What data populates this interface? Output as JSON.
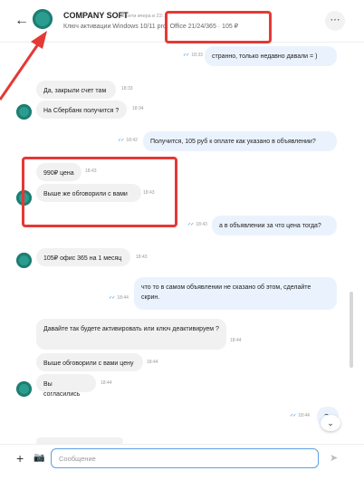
{
  "header": {
    "back_icon": "arrow-left-icon",
    "name": "COMPANY SOFT",
    "status": "В сети вчера в 22:...",
    "subtitle": "Ключ активации Windows 10/11 pro, Office 21/24/365 · 105 ₽",
    "menu": "⋯"
  },
  "messages": [
    {
      "dir": "out",
      "text": "странно, только недавно давали = )",
      "time": "18:33"
    },
    {
      "dir": "in",
      "text": "Да, закрыли счет там",
      "time": "18:33"
    },
    {
      "dir": "in",
      "text": "На Сбербанк получится ?",
      "time": "18:34"
    },
    {
      "dir": "out",
      "text": "Получится, 105 руб к оплате как указано в объявлении?",
      "time": "18:42"
    },
    {
      "dir": "in",
      "text": "990₽ цена",
      "time": "18:43"
    },
    {
      "dir": "in",
      "text": "Выше же обговорили с вами",
      "time": "18:43"
    },
    {
      "dir": "out",
      "text": "а в объявлении за что цена тогда?",
      "time": "18:43"
    },
    {
      "dir": "in",
      "text": "105₽ офис 365 на 1 месяц",
      "time": "18:43"
    },
    {
      "dir": "out",
      "text": "что то в самом объявлении не сказано об этом, сделайте скрин.",
      "time": "18:44"
    },
    {
      "dir": "in",
      "text": "Давайте так будете активировать или ключ деактивируем ?",
      "time": "18:44"
    },
    {
      "dir": "in",
      "text": "Выше обговорили с вами цену",
      "time": "18:44"
    },
    {
      "dir": "in",
      "text": "Вы согласились",
      "time": "18:44"
    },
    {
      "dir": "out",
      "text": "Эх",
      "time": "18:44"
    }
  ],
  "composer": {
    "placeholder": "Сообщение",
    "plus": "+",
    "camera": "📷",
    "send": "➤"
  },
  "scroll_down": "⌄",
  "colors": {
    "accent": "#2a9d8f",
    "annotation": "#e53935",
    "tick": "#1e88e5"
  }
}
